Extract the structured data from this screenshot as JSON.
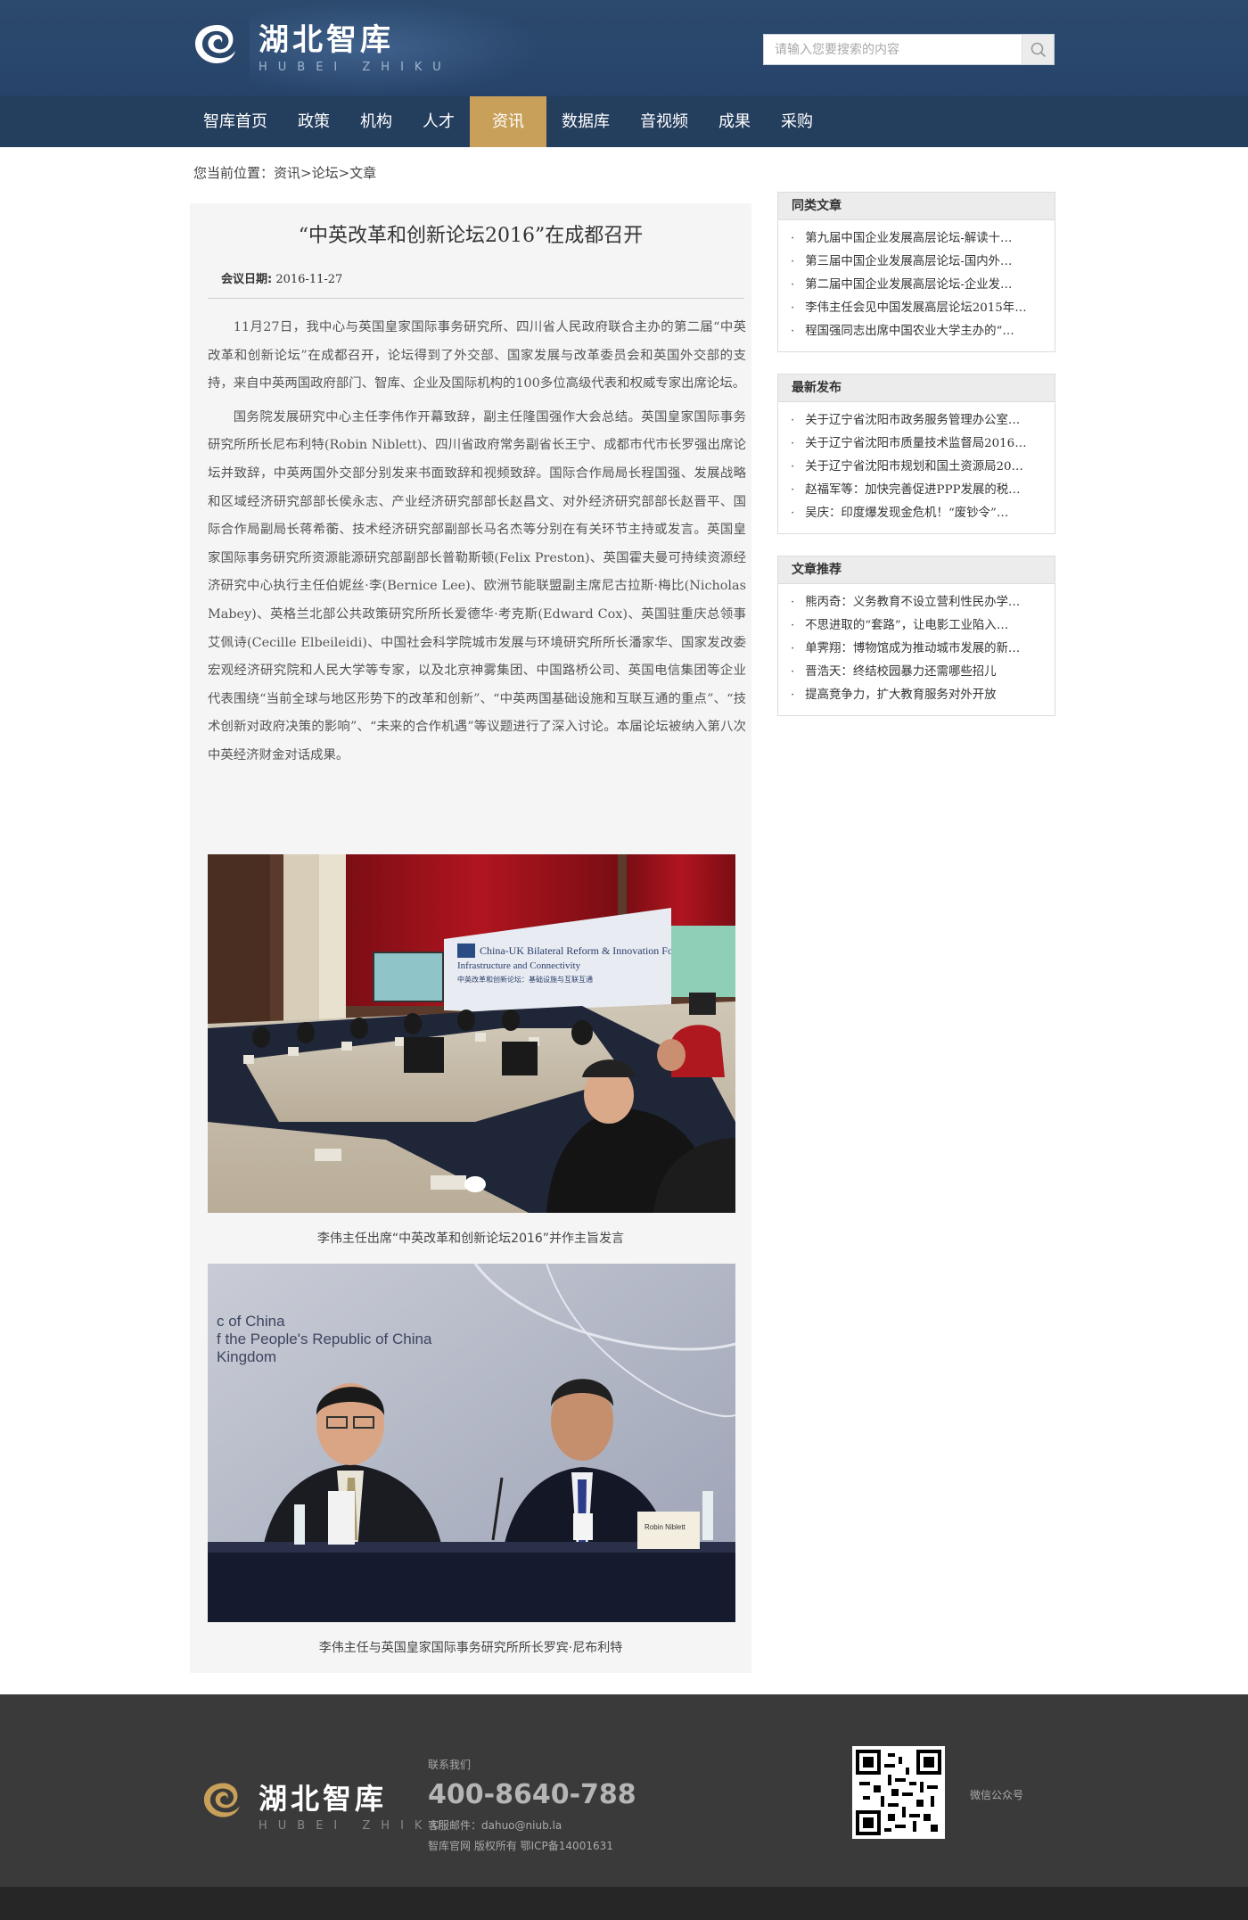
{
  "header": {
    "logo_cn": "湖北智库",
    "logo_en": "HUBEI ZHIKU",
    "search_placeholder": "请输入您要搜索的内容"
  },
  "nav": {
    "items": [
      "智库首页",
      "政策",
      "机构",
      "人才",
      "资讯",
      "数据库",
      "音视频",
      "成果",
      "采购"
    ],
    "active_index": 4
  },
  "breadcrumb": "您当前位置：资讯>论坛>文章",
  "article": {
    "title": "“中英改革和创新论坛2016”在成都召开",
    "date_label": "会议日期:",
    "date": "2016-11-27",
    "paragraphs": [
      "11月27日，我中心与英国皇家国际事务研究所、四川省人民政府联合主办的第二届“中英改革和创新论坛”在成都召开，论坛得到了外交部、国家发展与改革委员会和英国外交部的支持，来自中英两国政府部门、智库、企业及国际机构的100多位高级代表和权威专家出席论坛。",
      "国务院发展研究中心主任李伟作开幕致辞，副主任隆国强作大会总结。英国皇家国际事务研究所所长尼布利特(Robin  Niblett)、四川省政府常务副省长王宁、成都市代市长罗强出席论坛并致辞，中英两国外交部分别发来书面致辞和视频致辞。国际合作局局长程国强、发展战略和区域经济研究部部长侯永志、产业经济研究部部长赵昌文、对外经济研究部部长赵晋平、国际合作局副局长蒋希蘅、技术经济研究部副部长马名杰等分别在有关环节主持或发言。英国皇家国际事务研究所资源能源研究部副部长普勒斯顿(Felix  Preston)、英国霍夫曼可持续资源经济研究中心执行主任伯妮丝·李(Bernice  Lee)、欧洲节能联盟副主席尼古拉斯·梅比(Nicholas  Mabey)、英格兰北部公共政策研究所所长爱德华·考克斯(Edward Cox)、英国驻重庆总领事艾佩诗(Cecille Elbeileidi)、中国社会科学院城市发展与环境研究所所长潘家华、国家发改委宏观经济研究院和人民大学等专家，以及北京神雾集团、中国路桥公司、英国电信集团等企业代表围绕“当前全球与地区形势下的改革和创新”、“中英两国基础设施和互联互通的重点”、“技术创新对政府决策的影响”、“未来的合作机遇”等议题进行了深入讨论。本届论坛被纳入第八次中英经济财金对话成果。"
    ],
    "photo1_banner": "China-UK Bilateral Reform & Innovation Forum",
    "photo1_banner2": "Infrastructure and Connectivity",
    "photo1_banner_cn": "中英改革和创新论坛：基础设施与互联互通",
    "caption1": "李伟主任出席“中英改革和创新论坛2016”并作主旨发言",
    "photo2_text": [
      "c of China",
      "f the People's Republic of China",
      "Kingdom"
    ],
    "photo2_nameplate": "Robin Niblett",
    "caption2": "李伟主任与英国皇家国际事务研究所所长罗宾·尼布利特"
  },
  "sidebar": {
    "similar": {
      "title": "同类文章",
      "items": [
        "第九届中国企业发展高层论坛-解读十…",
        "第三届中国企业发展高层论坛-国内外…",
        "第二届中国企业发展高层论坛-企业发…",
        "李伟主任会见中国发展高层论坛2015年…",
        "程国强同志出席中国农业大学主办的“…"
      ]
    },
    "latest": {
      "title": "最新发布",
      "items": [
        "关于辽宁省沈阳市政务服务管理办公室…",
        "关于辽宁省沈阳市质量技术监督局2016…",
        "关于辽宁省沈阳市规划和国土资源局20…",
        "赵福军等：加快完善促进PPP发展的税…",
        "吴庆：印度爆发现金危机！“废钞令”…"
      ]
    },
    "recommend": {
      "title": "文章推荐",
      "items": [
        "熊丙奇：义务教育不设立营利性民办学…",
        "不思进取的“套路”，让电影工业陷入…",
        "单霁翔：博物馆成为推动城市发展的新…",
        "晋浩天：终结校园暴力还需哪些招儿",
        "提高竞争力，扩大教育服务对外开放"
      ]
    }
  },
  "footer": {
    "logo_cn": "湖北智库",
    "logo_en": "HUBEI ZHIKU",
    "contact_label": "联系我们",
    "phone": "400-8640-788",
    "email": "客服邮件：dahuo@niub.la",
    "copyright": "智库官网  版权所有  鄂ICP备14001631",
    "qr_label": "微信公众号"
  },
  "colors": {
    "header": "#2c4a6d",
    "nav": "#243e5e",
    "accent": "#c9a05a",
    "footer": "#3a3a3a"
  }
}
